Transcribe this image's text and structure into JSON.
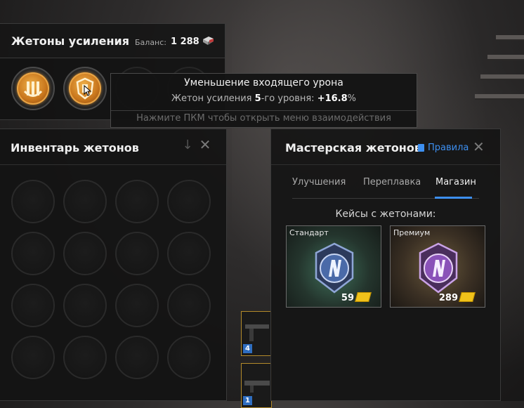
{
  "tokens_panel": {
    "title": "Жетоны усиления",
    "balance_label": "Баланс:",
    "balance_value": "1 288"
  },
  "tooltip": {
    "title": "Уменьшение входящего урона",
    "level_prefix": "Жетон усиления ",
    "level_number": "5",
    "level_mid": "-го уровня: ",
    "bonus": "+16.8",
    "percent": "%",
    "hint": "Нажмите ПКМ чтобы открыть меню взаимодействия"
  },
  "inventory_panel": {
    "title": "Инвентарь жетонов"
  },
  "weapon_cards": [
    {
      "number": "4"
    },
    {
      "number": "1"
    }
  ],
  "workshop_panel": {
    "title": "Мастерская жетонов",
    "rules_link": "Правила",
    "tabs": [
      {
        "label": "Улучшения",
        "active": false
      },
      {
        "label": "Переплавка",
        "active": false
      },
      {
        "label": "Магазин",
        "active": true
      }
    ],
    "cases_title": "Кейсы с жетонами:",
    "cases": [
      {
        "name": "Стандарт",
        "price": "59"
      },
      {
        "name": "Премиум",
        "price": "289"
      }
    ]
  },
  "colors": {
    "accent_blue": "#3d8ff0",
    "gold": "#f0c21a",
    "medal_orange": "#c9771d"
  }
}
